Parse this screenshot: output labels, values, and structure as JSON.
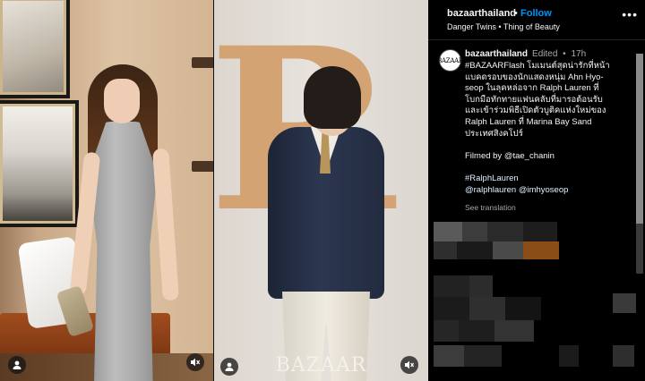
{
  "post": {
    "username": "bazaarthailand",
    "separator": "•",
    "follow_label": "Follow",
    "audio": "Danger Twins • Thing of Beauty",
    "more_icon": "more-horizontal-icon"
  },
  "caption": {
    "avatar_text": "BAZAAR",
    "username": "bazaarthailand",
    "edited": "Edited",
    "separator": "•",
    "time": "17h",
    "lines": [
      "#BAZAARFlash โมเมนต์สุดน่ารักที่หน้า",
      "แบคดรอบของนักแสดงหนุ่ม Ahn Hyo-",
      "seop ในลุคหล่อจาก Ralph Lauren ที่",
      "โบกมือทักทายแฟนคลับที่มารอต้อนรับ",
      "และเข้าร่วมพิธีเปิดตัวบูติคแห่งใหม่ของ",
      "Ralph Lauren ที่ Marina Bay Sand",
      "ประเทศสิงคโปร์"
    ],
    "filmed_by": "Filmed by @tae_chanin",
    "hashtag": "#RalphLauren",
    "mentions": "@ralphlauren @imhyoseop",
    "see_translation": "See translation"
  },
  "media": {
    "watermark": "BAZAAR",
    "left_profile_icon": "user-icon",
    "left_mute_icon": "muted-speaker-icon",
    "right_profile_icon": "user-icon",
    "right_mute_icon": "muted-speaker-icon"
  },
  "colors": {
    "accent": "#0095f6",
    "background": "#000000",
    "secondary_text": "#a8a8a8"
  }
}
